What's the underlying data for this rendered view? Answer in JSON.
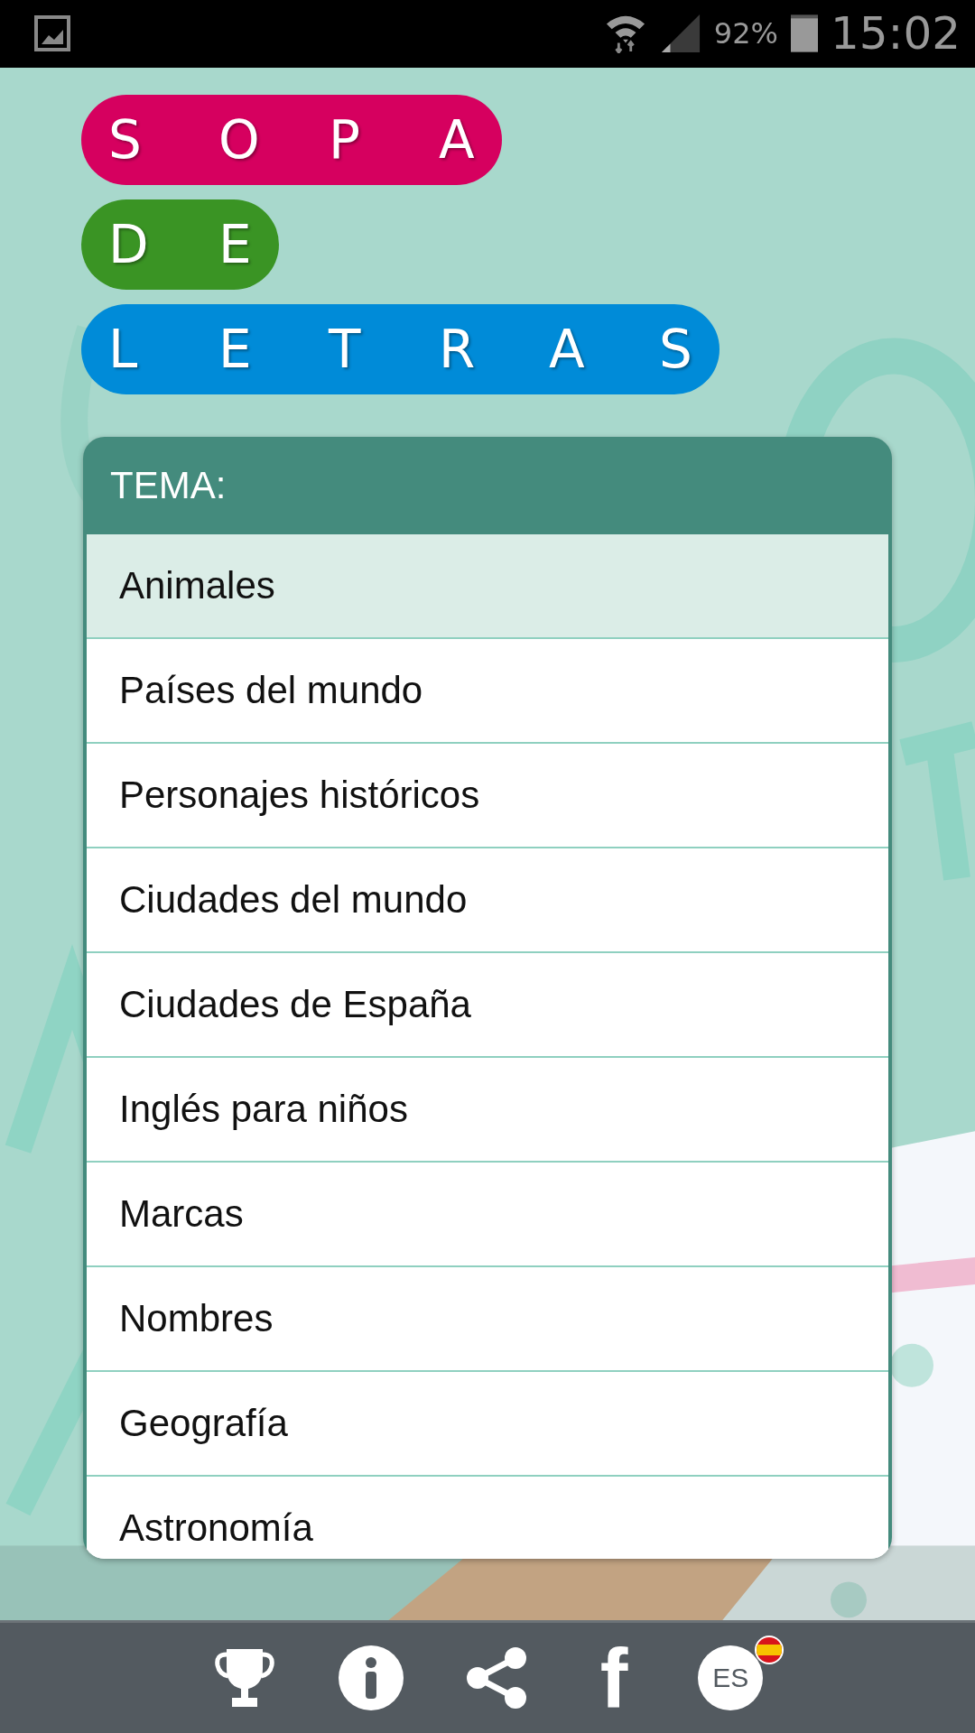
{
  "status_bar": {
    "battery": "92%",
    "time": "15:02"
  },
  "title_rows": [
    {
      "letters": [
        "S",
        "O",
        "P",
        "A"
      ],
      "color": "#d6005f"
    },
    {
      "letters": [
        "D",
        "E"
      ],
      "color": "#3a9424"
    },
    {
      "letters": [
        "L",
        "E",
        "T",
        "R",
        "A",
        "S"
      ],
      "color": "#008bd8"
    }
  ],
  "panel": {
    "title": "TEMA:",
    "items": [
      {
        "label": "Animales",
        "selected": true
      },
      {
        "label": "Países del mundo",
        "selected": false
      },
      {
        "label": "Personajes históricos",
        "selected": false
      },
      {
        "label": "Ciudades del mundo",
        "selected": false
      },
      {
        "label": "Ciudades de España",
        "selected": false
      },
      {
        "label": "Inglés para niños",
        "selected": false
      },
      {
        "label": "Marcas",
        "selected": false
      },
      {
        "label": "Nombres",
        "selected": false
      },
      {
        "label": "Geografía",
        "selected": false
      },
      {
        "label": "Astronomía",
        "selected": false
      }
    ]
  },
  "bottom_bar": [
    {
      "kind": "trophy"
    },
    {
      "kind": "info"
    },
    {
      "kind": "share"
    },
    {
      "kind": "facebook",
      "text": "f"
    },
    {
      "kind": "language",
      "text": "ES"
    }
  ]
}
